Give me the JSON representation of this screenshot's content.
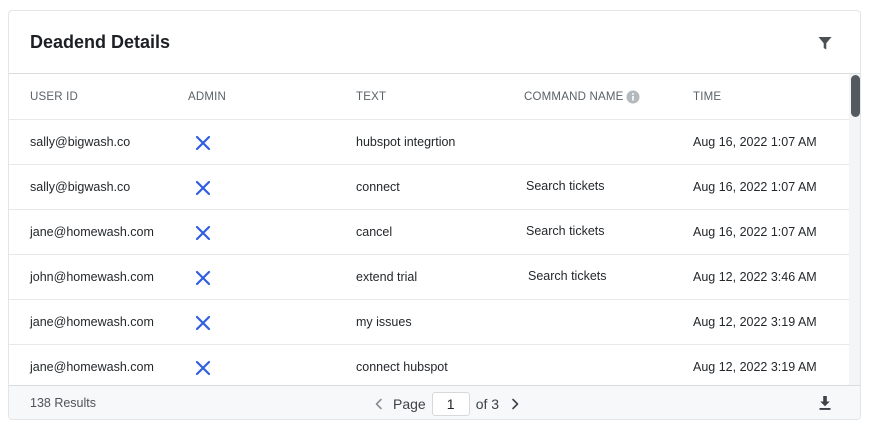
{
  "card": {
    "title": "Deadend Details"
  },
  "table": {
    "columns": [
      "USER ID",
      "ADMIN",
      "TEXT",
      "COMMAND NAME",
      "TIME"
    ],
    "rows": [
      {
        "user_id": "sally@bigwash.co",
        "admin": "no",
        "text": "hubspot integrtion",
        "command_name": "",
        "time": "Aug 16, 2022 1:07 AM"
      },
      {
        "user_id": "sally@bigwash.co",
        "admin": "no",
        "text": "connect",
        "command_name": "Search tickets",
        "time": "Aug 16, 2022 1:07 AM"
      },
      {
        "user_id": "jane@homewash.com",
        "admin": "no",
        "text": "cancel",
        "command_name": "Search tickets",
        "time": "Aug 16, 2022 1:07 AM"
      },
      {
        "user_id": "john@homewash.com",
        "admin": "no",
        "text": "extend trial",
        "command_name": "Search tickets",
        "time": "Aug 12, 2022 3:46 AM"
      },
      {
        "user_id": "jane@homewash.com",
        "admin": "no",
        "text": "my issues",
        "command_name": "",
        "time": "Aug 12, 2022 3:19 AM"
      },
      {
        "user_id": "jane@homewash.com",
        "admin": "no",
        "text": "connect hubspot",
        "command_name": "",
        "time": "Aug 12, 2022 3:19 AM"
      }
    ]
  },
  "footer": {
    "results": "138 Results",
    "page_label": "Page",
    "page_value": "1",
    "of_label": "of 3"
  },
  "icons": {
    "filter": "filter-icon",
    "info": "info-icon",
    "admin_no": "close-icon",
    "prev": "chevron-left-icon",
    "next": "chevron-right-icon",
    "download": "download-icon"
  },
  "colors": {
    "admin_x": "#2f5fe0",
    "icon_gray": "#4a5056"
  }
}
